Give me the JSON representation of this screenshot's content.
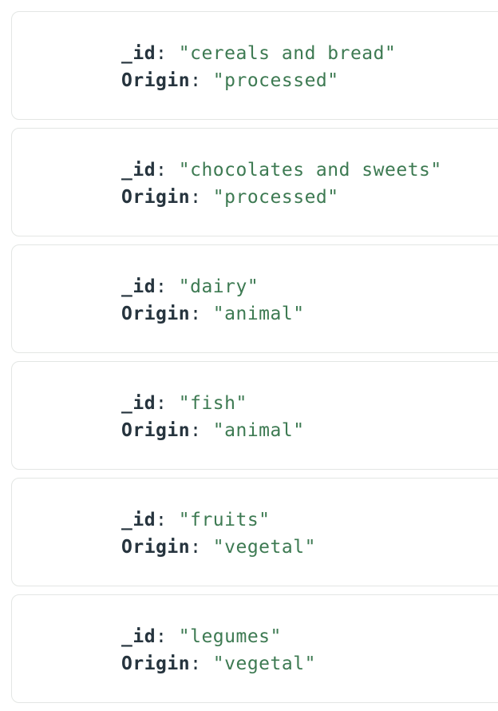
{
  "documents": [
    {
      "id_key": "_id",
      "id_value": "\"cereals and bread\"",
      "origin_key": "Origin",
      "origin_value": "\"processed\""
    },
    {
      "id_key": "_id",
      "id_value": "\"chocolates and sweets\"",
      "origin_key": "Origin",
      "origin_value": "\"processed\""
    },
    {
      "id_key": "_id",
      "id_value": "\"dairy\"",
      "origin_key": "Origin",
      "origin_value": "\"animal\""
    },
    {
      "id_key": "_id",
      "id_value": "\"fish\"",
      "origin_key": "Origin",
      "origin_value": "\"animal\""
    },
    {
      "id_key": "_id",
      "id_value": "\"fruits\"",
      "origin_key": "Origin",
      "origin_value": "\"vegetal\""
    },
    {
      "id_key": "_id",
      "id_value": "\"legumes\"",
      "origin_key": "Origin",
      "origin_value": "\"vegetal\""
    }
  ],
  "colors": {
    "key_text": "#26343e",
    "value_text": "#3d7a52",
    "card_border": "#e3e6e4"
  }
}
